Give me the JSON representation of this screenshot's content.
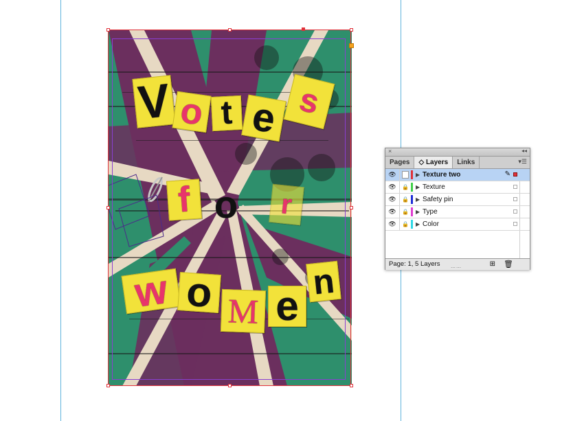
{
  "document": {
    "poster_letters": [
      {
        "char": "V",
        "style": "dark"
      },
      {
        "char": "o",
        "style": "dark"
      },
      {
        "char": "t",
        "style": "dark"
      },
      {
        "char": "e",
        "style": "dark"
      },
      {
        "char": "s",
        "style": "pink"
      },
      {
        "char": "f",
        "style": "pink"
      },
      {
        "char": "o",
        "style": "dark"
      },
      {
        "char": "r",
        "style": "pink"
      },
      {
        "char": "w",
        "style": "pink"
      },
      {
        "char": "o",
        "style": "dark"
      },
      {
        "char": "M",
        "style": "pink"
      },
      {
        "char": "e",
        "style": "dark"
      },
      {
        "char": "n",
        "style": "dark"
      }
    ],
    "colors": {
      "green": "#2e8f6c",
      "purple": "#6b2f5e",
      "cream": "#e7d9c3",
      "tile": "#f2e23a",
      "pink": "#e8356b",
      "frame": "#e0313a",
      "margin": "#8a3fd1",
      "guide": "#5fb3dc"
    }
  },
  "panel": {
    "close_glyph": "×",
    "collapse_glyph": "◂◂",
    "tabs": [
      {
        "label": "Pages",
        "active": false
      },
      {
        "label": "◇ Layers",
        "active": true
      },
      {
        "label": "Links",
        "active": false
      }
    ],
    "menu_glyph": "▾☰",
    "layers": [
      {
        "name": "Texture two",
        "color": "#e0313a",
        "selected": true,
        "locked": false
      },
      {
        "name": "Texture",
        "color": "#3fcf4a",
        "selected": false,
        "locked": true
      },
      {
        "name": "Safety pin",
        "color": "#1f2fd6",
        "selected": false,
        "locked": true
      },
      {
        "name": "Type",
        "color": "#e03cd0",
        "selected": false,
        "locked": true
      },
      {
        "name": "Color",
        "color": "#2fd8e6",
        "selected": false,
        "locked": true
      }
    ],
    "status": "Page: 1, 5 Layers",
    "eye_glyph": "👁",
    "lock_glyph": "🔒",
    "triangle_glyph": "▶",
    "pen_glyph": "✎",
    "new_layer_glyph": "⊞",
    "trash_glyph": "🗑",
    "grip_glyph": "⋯⋯"
  }
}
